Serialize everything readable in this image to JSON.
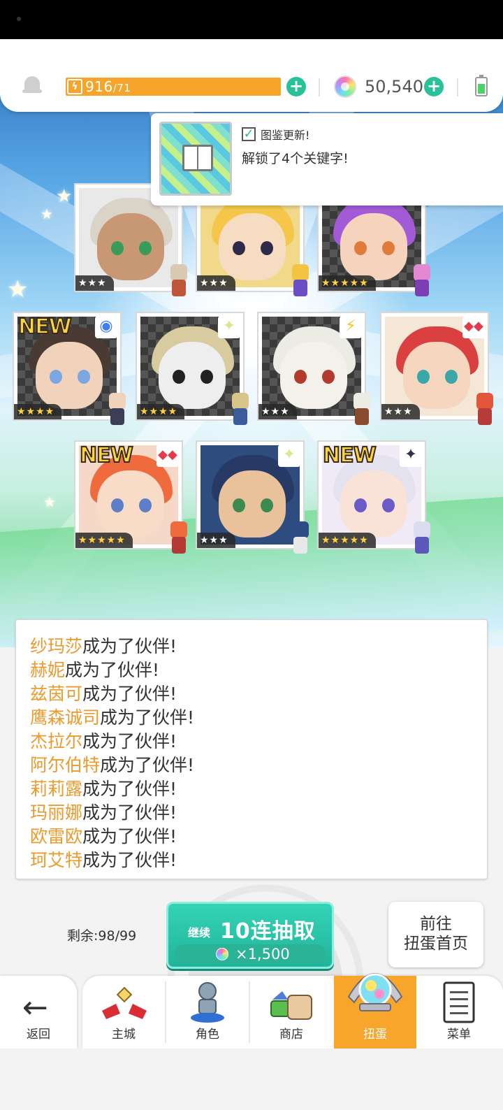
{
  "topbar": {
    "energy_current": "916",
    "energy_max": "/71",
    "gems": "50,540"
  },
  "toast": {
    "title": "图鉴更新!",
    "message": "解锁了4个关键字!"
  },
  "cards": [
    {
      "stars": "★★★",
      "rarity": "gold_no",
      "new": "",
      "element": "circle"
    },
    {
      "stars": "★★★",
      "new": "",
      "element": "none"
    },
    {
      "stars": "★★★★★",
      "new": "",
      "element": "none"
    },
    {
      "stars": "★★★★",
      "new": "NEW",
      "element": "◉"
    },
    {
      "stars": "★★★★",
      "new": "",
      "element": "✦"
    },
    {
      "stars": "★★★",
      "new": "",
      "element": "⚡"
    },
    {
      "stars": "★★★",
      "new": "",
      "element": "◆◆"
    },
    {
      "stars": "★★★★★",
      "new": "NEW",
      "element": "◆◆"
    },
    {
      "stars": "★★★",
      "new": "",
      "element": "✦"
    },
    {
      "stars": "★★★★★",
      "new": "NEW",
      "element": "✦"
    }
  ],
  "messages": [
    {
      "name": "纱玛莎",
      "text": "成为了伙伴!"
    },
    {
      "name": "赫妮",
      "text": "成为了伙伴!"
    },
    {
      "name": "兹茵可",
      "text": "成为了伙伴!"
    },
    {
      "name": "鹰森诚司",
      "text": "成为了伙伴!"
    },
    {
      "name": "杰拉尔",
      "text": "成为了伙伴!"
    },
    {
      "name": "阿尔伯特",
      "text": "成为了伙伴!"
    },
    {
      "name": "莉莉露",
      "text": "成为了伙伴!"
    },
    {
      "name": "玛丽娜",
      "text": "成为了伙伴!"
    },
    {
      "name": "欧雷欧",
      "text": "成为了伙伴!"
    },
    {
      "name": "珂艾特",
      "text": "成为了伙伴!"
    }
  ],
  "action": {
    "remaining_label": "剩余:",
    "remaining_value": "98/99",
    "continue_label": "继续",
    "pull_label": "10连抽取",
    "pull_cost": "×1,500",
    "goto_label_1": "前往",
    "goto_label_2": "扭蛋首页"
  },
  "nav": {
    "back": "返回",
    "tabs": [
      "主城",
      "角色",
      "商店",
      "扭蛋",
      "菜单"
    ],
    "active": "扭蛋"
  },
  "colors": {
    "accent_orange": "#f8a52b",
    "name_orange": "#ec9a2c",
    "teal": "#29c19a"
  }
}
